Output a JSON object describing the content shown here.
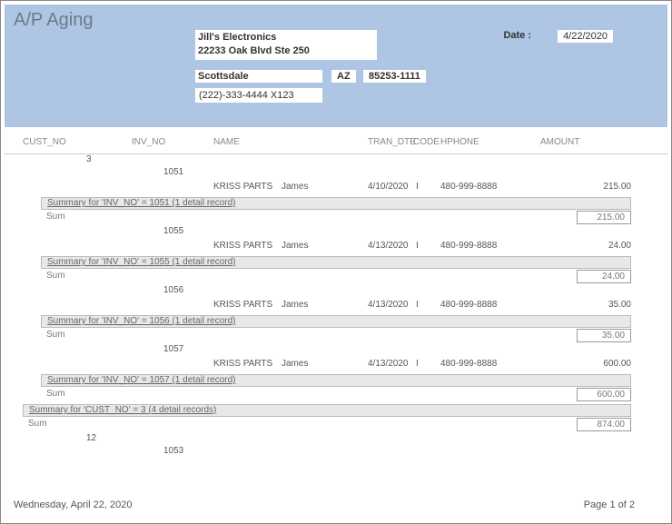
{
  "report": {
    "title": "A/P Aging",
    "date_label": "Date :",
    "date_value": "4/22/2020"
  },
  "company": {
    "name": "Jill's Electronics",
    "address": "22233 Oak Blvd  Ste 250",
    "city": "Scottsdale",
    "state": "AZ",
    "zip": "85253-1111",
    "phone": "(222)-333-4444 X123"
  },
  "columns": {
    "cust_no": "CUST_NO",
    "inv_no": "INV_NO",
    "name": "NAME",
    "tran_dte": "TRAN_DTE",
    "code": "CODE",
    "hphone": "HPHONE",
    "amount": "AMOUNT"
  },
  "cust3": {
    "id": "3",
    "inv1051": {
      "id": "1051",
      "name": "KRISS PARTS",
      "fname": "James",
      "tran": "4/10/2020",
      "code": "I",
      "phone": "480-999-8888",
      "amount": "215.00",
      "summary": "Summary for 'INV_NO' = 1051 (1 detail record)",
      "sum_label": "Sum",
      "sum": "215.00"
    },
    "inv1055": {
      "id": "1055",
      "name": "KRISS PARTS",
      "fname": "James",
      "tran": "4/13/2020",
      "code": "I",
      "phone": "480-999-8888",
      "amount": "24.00",
      "summary": "Summary for 'INV_NO' = 1055 (1 detail record)",
      "sum_label": "Sum",
      "sum": "24.00"
    },
    "inv1056": {
      "id": "1056",
      "name": "KRISS PARTS",
      "fname": "James",
      "tran": "4/13/2020",
      "code": "I",
      "phone": "480-999-8888",
      "amount": "35.00",
      "summary": "Summary for 'INV_NO' = 1056 (1 detail record)",
      "sum_label": "Sum",
      "sum": "35.00"
    },
    "inv1057": {
      "id": "1057",
      "name": "KRISS PARTS",
      "fname": "James",
      "tran": "4/13/2020",
      "code": "I",
      "phone": "480-999-8888",
      "amount": "600.00",
      "summary": "Summary for 'INV_NO' = 1057 (1 detail record)",
      "sum_label": "Sum",
      "sum": "600.00"
    },
    "summary": "Summary for 'CUST_NO' = 3 (4 detail records)",
    "sum_label": "Sum",
    "sum": "874.00"
  },
  "cust12": {
    "id": "12",
    "inv1053": {
      "id": "1053"
    }
  },
  "footer": {
    "date": "Wednesday, April 22, 2020",
    "page": "Page 1 of 2"
  }
}
